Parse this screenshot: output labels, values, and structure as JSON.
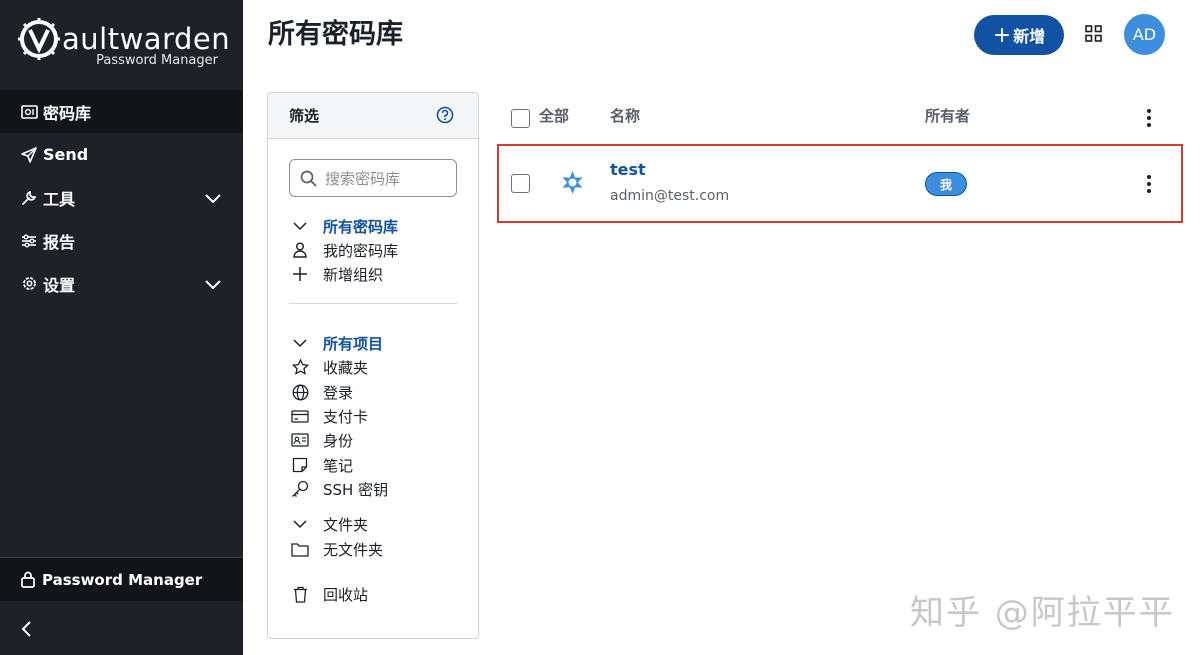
{
  "sidebar": {
    "brand_name": "aultwarden",
    "brand_sub": "Password Manager",
    "items": [
      {
        "label": "密码库",
        "icon": "vault-icon"
      },
      {
        "label": "Send",
        "icon": "send-icon"
      },
      {
        "label": "工具",
        "icon": "wrench-icon"
      },
      {
        "label": "报告",
        "icon": "sliders-icon"
      },
      {
        "label": "设置",
        "icon": "gear-icon"
      }
    ],
    "bottom_label": "Password Manager"
  },
  "header": {
    "title": "所有密码库",
    "new_label": "新增",
    "avatar_initials": "AD"
  },
  "filter": {
    "title": "筛选",
    "search_placeholder": "搜索密码库",
    "vaults_header": "所有密码库",
    "my_vault": "我的密码库",
    "new_org": "新增组织",
    "items_header": "所有项目",
    "favorites": "收藏夹",
    "login": "登录",
    "card": "支付卡",
    "identity": "身份",
    "note": "笔记",
    "ssh_key": "SSH 密钥",
    "folders_header": "文件夹",
    "no_folder": "无文件夹",
    "trash": "回收站"
  },
  "table": {
    "col_all": "全部",
    "col_name": "名称",
    "col_owner": "所有者",
    "rows": [
      {
        "name": "test",
        "username": "admin@test.com",
        "owner": "我"
      }
    ]
  },
  "watermark": "知乎 @阿拉平平",
  "colors": {
    "sidebar": "#1e2228",
    "accent": "#1252a3",
    "highlight": "#d93a2b"
  }
}
